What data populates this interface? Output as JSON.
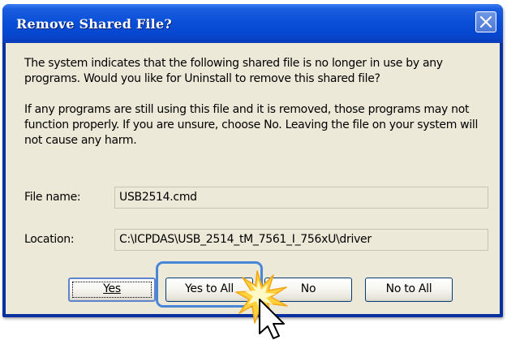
{
  "dialog": {
    "title": "Remove Shared File?",
    "message1": "The system indicates that the following shared file is no longer in use by any programs. Would you like for Uninstall to remove this shared file?",
    "message2": "If any programs are still using this file and it is removed, those programs may not function properly. If you are unsure, choose No. Leaving the file on your system will not cause any harm.",
    "file_name_label": "File name:",
    "file_name_value": "USB2514.cmd",
    "location_label": "Location:",
    "location_value": "C:\\ICPDAS\\USB_2514_tM_7561_I_756xU\\driver"
  },
  "buttons": {
    "yes": "Yes",
    "yes_to_all": "Yes to All",
    "no": "No",
    "no_to_all": "No to All"
  },
  "icons": {
    "close": "close-icon",
    "pointer": "mouse-pointer-icon",
    "click": "click-burst-icon"
  },
  "colors": {
    "titlebar": "#0a4fd8",
    "dialog_face": "#ece9d8",
    "highlight": "#4a86d8",
    "click_burst": "#ffd23c"
  }
}
